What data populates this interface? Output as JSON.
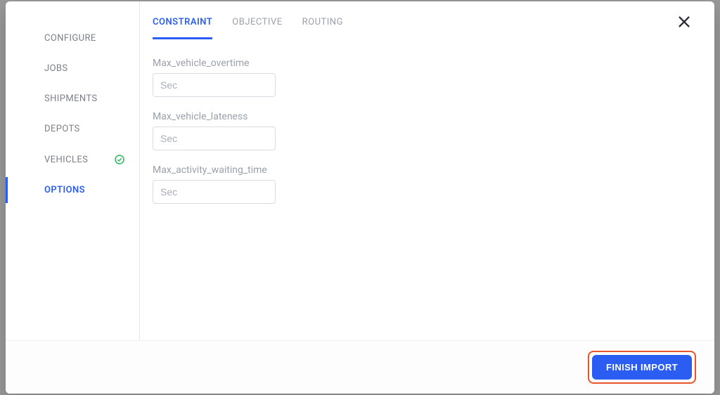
{
  "sidebar": {
    "items": [
      {
        "label": "CONFIGURE",
        "active": false,
        "checked": false
      },
      {
        "label": "JOBS",
        "active": false,
        "checked": false
      },
      {
        "label": "SHIPMENTS",
        "active": false,
        "checked": false
      },
      {
        "label": "DEPOTS",
        "active": false,
        "checked": false
      },
      {
        "label": "VEHICLES",
        "active": false,
        "checked": true
      },
      {
        "label": "OPTIONS",
        "active": true,
        "checked": false
      }
    ]
  },
  "tabs": [
    {
      "label": "CONSTRAINT",
      "active": true
    },
    {
      "label": "OBJECTIVE",
      "active": false
    },
    {
      "label": "ROUTING",
      "active": false
    }
  ],
  "fields": [
    {
      "label": "Max_vehicle_overtime",
      "placeholder": "Sec",
      "value": ""
    },
    {
      "label": "Max_vehicle_lateness",
      "placeholder": "Sec",
      "value": ""
    },
    {
      "label": "Max_activity_waiting_time",
      "placeholder": "Sec",
      "value": ""
    }
  ],
  "footer": {
    "finish_label": "FINISH IMPORT"
  },
  "colors": {
    "accent": "#2b5df2",
    "success": "#28b759",
    "highlight": "#e9542b"
  }
}
